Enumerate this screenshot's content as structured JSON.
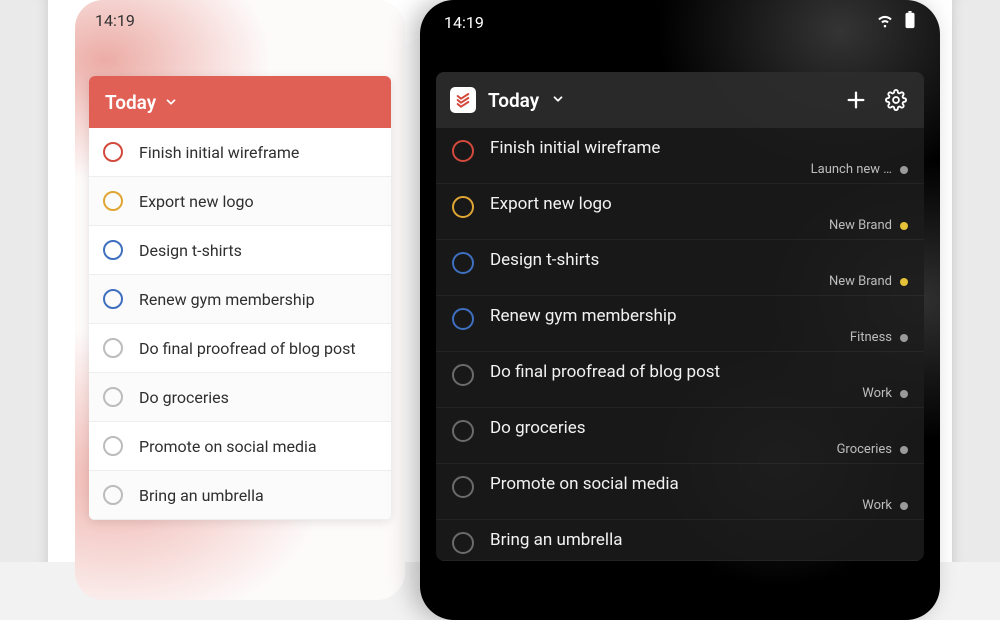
{
  "status_time": "14:19",
  "light": {
    "header_title": "Today",
    "tasks": [
      {
        "label": "Finish initial wireframe",
        "ring": "#d34a3d"
      },
      {
        "label": "Export new logo",
        "ring": "#e0a634"
      },
      {
        "label": "Design t-shirts",
        "ring": "#3f6fbf"
      },
      {
        "label": "Renew gym membership",
        "ring": "#3f6fbf"
      },
      {
        "label": "Do final proofread of blog post",
        "ring": "#bcbcbc"
      },
      {
        "label": "Do groceries",
        "ring": "#bcbcbc"
      },
      {
        "label": "Promote on social media",
        "ring": "#bcbcbc"
      },
      {
        "label": "Bring an umbrella",
        "ring": "#bcbcbc"
      }
    ]
  },
  "dark": {
    "header_title": "Today",
    "tasks": [
      {
        "label": "Finish initial wireframe",
        "ring": "#d34a3d",
        "project": "Launch new …",
        "dot": "#9a9a9a"
      },
      {
        "label": "Export new logo",
        "ring": "#e0a634",
        "project": "New Brand",
        "dot": "#e4c23a"
      },
      {
        "label": "Design t-shirts",
        "ring": "#3f6fbf",
        "project": "New Brand",
        "dot": "#e4c23a"
      },
      {
        "label": "Renew gym membership",
        "ring": "#3f6fbf",
        "project": "Fitness",
        "dot": "#9a9a9a"
      },
      {
        "label": "Do final proofread of blog post",
        "ring": "#6b6b6b",
        "project": "Work",
        "dot": "#9a9a9a"
      },
      {
        "label": "Do groceries",
        "ring": "#6b6b6b",
        "project": "Groceries",
        "dot": "#9a9a9a"
      },
      {
        "label": "Promote on social media",
        "ring": "#6b6b6b",
        "project": "Work",
        "dot": "#9a9a9a"
      },
      {
        "label": "Bring an umbrella",
        "ring": "#6b6b6b",
        "project": "",
        "dot": ""
      }
    ]
  }
}
